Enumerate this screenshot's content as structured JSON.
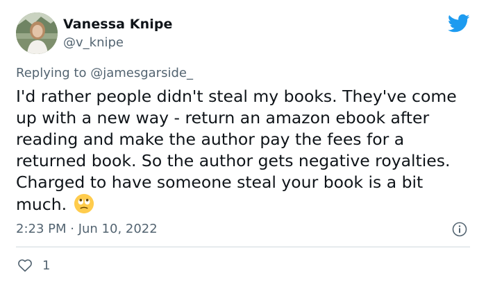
{
  "author": {
    "display_name": "Vanessa Knipe",
    "handle": "@v_knipe"
  },
  "reply": {
    "prefix": "Replying to ",
    "mention": "@jamesgarside_"
  },
  "tweet": {
    "text": "I'd rather people didn't steal my books. They've come up with a new way - return an amazon ebook after reading and make the author pay the fees for a returned book. So the author gets negative royalties. Charged to have someone steal your book is a bit much.",
    "emoji": "face-with-rolling-eyes",
    "timestamp": "2:23 PM · Jun 10, 2022"
  },
  "engagement": {
    "likes": "1"
  },
  "icons": {
    "brand": "twitter-bird-icon",
    "info": "info-icon",
    "like": "heart-icon"
  },
  "colors": {
    "brand_blue": "#1d9bf0",
    "text_primary": "#0f1419",
    "text_secondary": "#536471",
    "divider": "#cfd9de"
  }
}
